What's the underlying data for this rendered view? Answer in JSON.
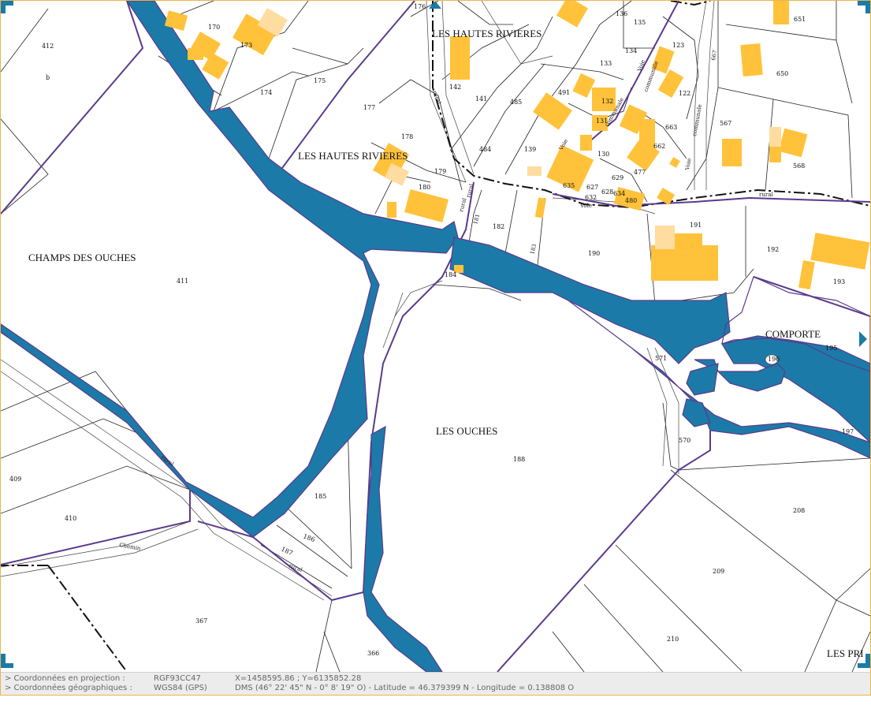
{
  "map": {
    "lieux_dits": [
      {
        "id": "hautes-rivieres-top",
        "label": "LES HAUTES RIVIERES"
      },
      {
        "id": "hautes-rivieres-mid",
        "label": "LES HAUTES RIVIERES"
      },
      {
        "id": "champs-des-ouches",
        "label": "CHAMPS DES OUCHES"
      },
      {
        "id": "les-ouches",
        "label": "LES OUCHES"
      },
      {
        "id": "comporte",
        "label": "COMPORTE"
      },
      {
        "id": "les-pri",
        "label": "LES PRI"
      }
    ],
    "parcels": [
      "412",
      "b",
      "170",
      "173",
      "174",
      "175",
      "176",
      "177",
      "178",
      "179",
      "180",
      "142",
      "141",
      "485",
      "484",
      "139",
      "491",
      "133",
      "136",
      "135",
      "134",
      "123",
      "122",
      "132",
      "131",
      "130",
      "663",
      "662",
      "635",
      "627",
      "628",
      "629",
      "632",
      "634",
      "477",
      "480",
      "181",
      "182",
      "183",
      "184",
      "190",
      "191",
      "192",
      "193",
      "411",
      "571",
      "195",
      "196",
      "197",
      "570",
      "188",
      "208",
      "209",
      "210",
      "185",
      "186",
      "187",
      "409",
      "410",
      "367",
      "366",
      "567",
      "568",
      "650",
      "651",
      "667"
    ],
    "road_labels": [
      "rural",
      "rural",
      "Chemin",
      "rural",
      "rural",
      "rural",
      "Voie",
      "communale",
      "Voie",
      "communale",
      "Voie",
      "communale",
      "rural",
      "Voie"
    ],
    "colors": {
      "water": "#1c7aa8",
      "boundary": "#5b3a8c",
      "building": "#ffc23a",
      "building_light": "#ffdca0"
    }
  },
  "coords": {
    "proj_label": "> Coordonnées en projection :",
    "proj_system": "RGF93CC47",
    "proj_value": "X=1458595.86 ; Y=6135852.28",
    "geo_label": "> Coordonnées géographiques :",
    "geo_system": "WGS84 (GPS)",
    "geo_value": "DMS (46° 22' 45\" N - 0° 8' 19\" O) - Latitude = 46.379399 N - Longitude = 0.138808 O"
  }
}
